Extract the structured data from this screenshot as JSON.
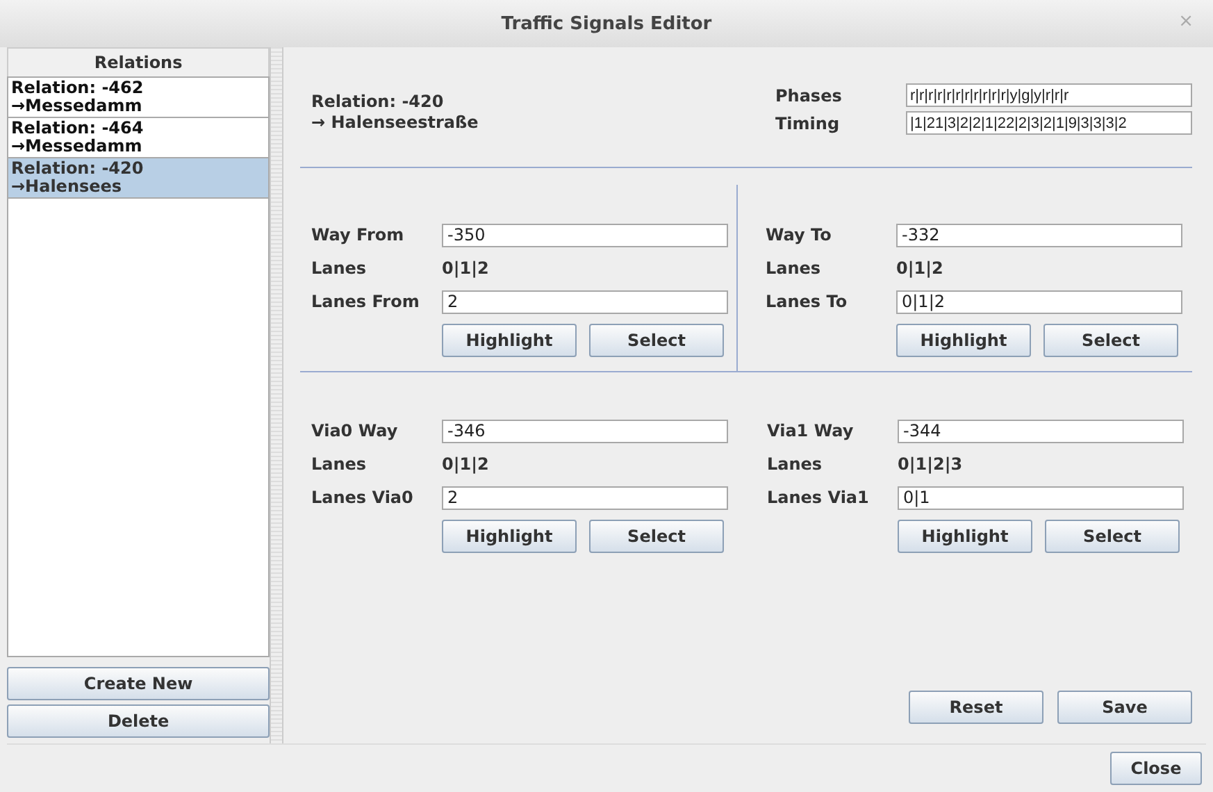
{
  "window": {
    "title": "Traffic Signals Editor",
    "close": "×"
  },
  "relations": {
    "header": "Relations",
    "items": [
      {
        "line1": "Relation: -462",
        "line2": "→Messedamm",
        "selected": false
      },
      {
        "line1": "Relation: -464",
        "line2": "→Messedamm",
        "selected": false
      },
      {
        "line1": "Relation: -420",
        "line2": "→Halensees",
        "selected": true
      }
    ],
    "buttons": [
      "Create New",
      "Delete"
    ]
  },
  "relation": {
    "line1": "Relation: -420",
    "line2": "→ Halenseestraße"
  },
  "phases": {
    "label": "Phases",
    "value": "r|r|r|r|r|r|r|r|r|r|r|y|g|y|r|r|r"
  },
  "timing": {
    "label": "Timing",
    "value": "|1|21|3|2|2|1|22|2|3|2|1|9|3|3|3|2"
  },
  "ways": [
    {
      "way_label": "Way From",
      "way": "-350",
      "lanes_label": "Lanes",
      "lanes": "0|1|2",
      "sel_label": "Lanes From",
      "sel": "2",
      "buttons": [
        "Highlight",
        "Select"
      ]
    },
    {
      "way_label": "Way To",
      "way": "-332",
      "lanes_label": "Lanes",
      "lanes": "0|1|2",
      "sel_label": "Lanes To",
      "sel": "0|1|2",
      "buttons": [
        "Highlight",
        "Select"
      ]
    },
    {
      "way_label": "Via0 Way",
      "way": "-346",
      "lanes_label": "Lanes",
      "lanes": "0|1|2",
      "sel_label": "Lanes Via0",
      "sel": "2",
      "buttons": [
        "Highlight",
        "Select"
      ]
    },
    {
      "way_label": "Via1 Way",
      "way": "-344",
      "lanes_label": "Lanes",
      "lanes": "0|1|2|3",
      "sel_label": "Lanes Via1",
      "sel": "0|1",
      "buttons": [
        "Highlight",
        "Select"
      ]
    }
  ],
  "actions": [
    "Reset",
    "Save"
  ],
  "footer": {
    "button": "Close"
  }
}
